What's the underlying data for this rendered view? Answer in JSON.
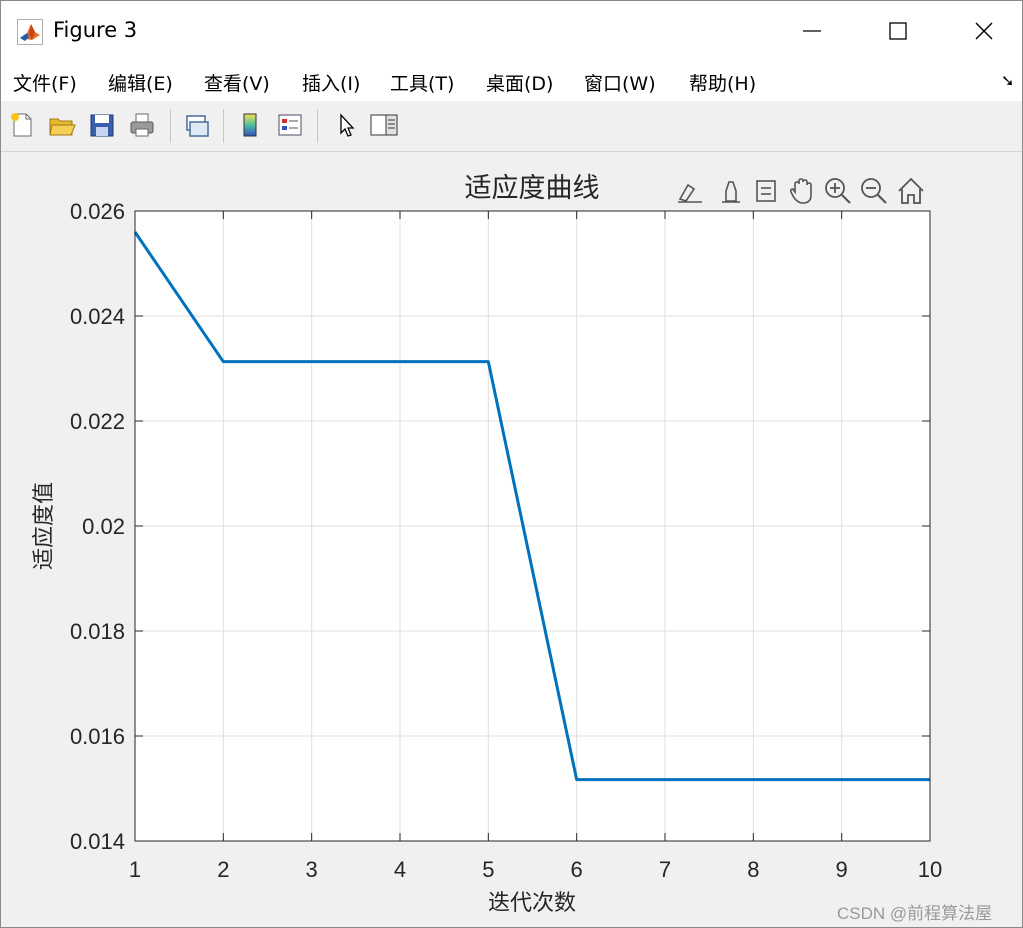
{
  "window": {
    "title": "Figure 3",
    "controls": {
      "minimize": "—",
      "maximize": "☐",
      "close": "✕"
    }
  },
  "menubar": {
    "items": [
      "文件(F)",
      "编辑(E)",
      "查看(V)",
      "插入(I)",
      "工具(T)",
      "桌面(D)",
      "窗口(W)",
      "帮助(H)"
    ],
    "overflow_icon": "dock-arrow-icon"
  },
  "toolbar": {
    "buttons": [
      "new-figure-icon",
      "open-file-icon",
      "save-icon",
      "print-icon",
      "link-plot-icon",
      "colorbar-icon",
      "legend-icon",
      "edit-plot-pointer-icon",
      "property-inspector-icon"
    ]
  },
  "axes_toolbar": {
    "buttons": [
      "brush-icon",
      "data-tips-icon",
      "legend-toggle-icon",
      "pan-icon",
      "zoom-in-icon",
      "zoom-out-icon",
      "home-icon"
    ]
  },
  "chart_data": {
    "type": "line",
    "title": "适应度曲线",
    "xlabel": "迭代次数",
    "ylabel": "适应度值",
    "x": [
      1,
      2,
      3,
      4,
      5,
      6,
      7,
      8,
      9,
      10
    ],
    "series": [
      {
        "values": [
          0.0256,
          0.02313,
          0.02313,
          0.02313,
          0.02313,
          0.01517,
          0.01517,
          0.01517,
          0.01517,
          0.01517
        ],
        "color": "#0072bd"
      }
    ],
    "xlim": [
      1,
      10
    ],
    "ylim": [
      0.014,
      0.026
    ],
    "xticks": [
      "1",
      "2",
      "3",
      "4",
      "5",
      "6",
      "7",
      "8",
      "9",
      "10"
    ],
    "yticks": [
      "0.014",
      "0.016",
      "0.018",
      "0.02",
      "0.022",
      "0.024",
      "0.026"
    ],
    "grid": true
  },
  "watermark": "CSDN @前程算法屋"
}
